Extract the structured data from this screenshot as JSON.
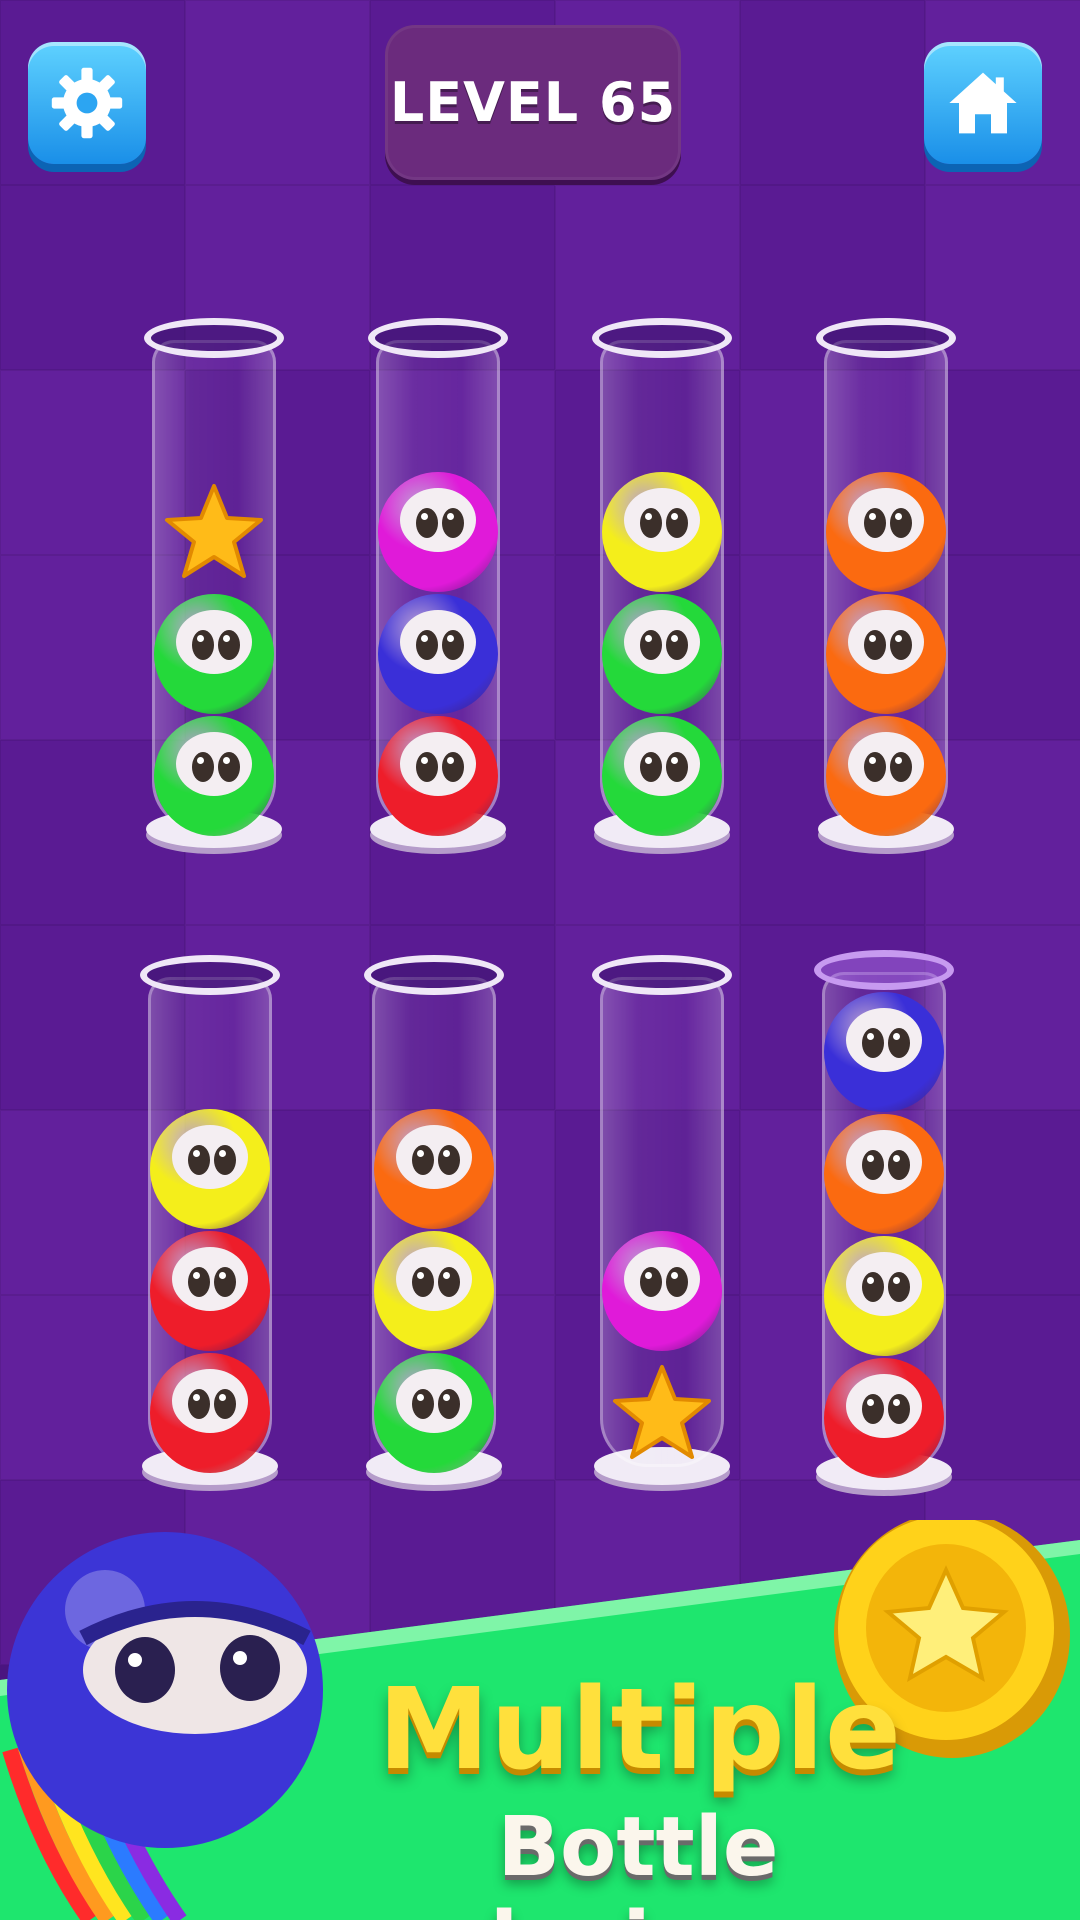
{
  "header": {
    "level_label": "LEVEL 65",
    "settings_icon": "gear-icon",
    "home_icon": "home-icon"
  },
  "colors": {
    "green": "#24d93a",
    "red": "#ee1d2a",
    "blue": "#3a2fd8",
    "magenta": "#e01ad9",
    "yellow": "#f4ee1b",
    "orange": "#fb6a10",
    "star": "#ffbb18",
    "background": "#4a1580",
    "banner_green": "#1ee66e"
  },
  "tubes": [
    {
      "name": "tube-1",
      "items": [
        "green",
        "green",
        "star"
      ]
    },
    {
      "name": "tube-2",
      "items": [
        "red",
        "blue",
        "magenta"
      ]
    },
    {
      "name": "tube-3",
      "items": [
        "green",
        "green",
        "yellow"
      ]
    },
    {
      "name": "tube-4",
      "items": [
        "orange",
        "orange",
        "orange"
      ]
    },
    {
      "name": "tube-5",
      "items": [
        "red",
        "red",
        "yellow"
      ]
    },
    {
      "name": "tube-6",
      "items": [
        "green",
        "yellow",
        "orange"
      ]
    },
    {
      "name": "tube-7",
      "items": [
        "star",
        "magenta"
      ]
    },
    {
      "name": "tube-8",
      "items": [
        "red",
        "yellow",
        "orange",
        "blue"
      ]
    }
  ],
  "banner": {
    "title": "Multiple",
    "subtitle": "Bottle designs",
    "coin_icon": "star-coin-icon",
    "mascot": "blue-ball-mascot"
  }
}
